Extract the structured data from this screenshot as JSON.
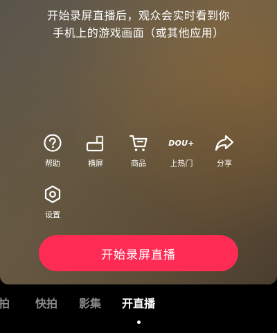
{
  "tip": {
    "line1": "开始录屏直播后，观众会实时看到你",
    "line2": "手机上的游戏画面（或其他应用）"
  },
  "tools": [
    {
      "label": "帮助",
      "icon": "help-icon"
    },
    {
      "label": "横屏",
      "icon": "landscape-icon"
    },
    {
      "label": "商品",
      "icon": "cart-icon"
    },
    {
      "label": "上热门",
      "icon": "dou-plus-icon",
      "icon_text": "DOU+"
    },
    {
      "label": "分享",
      "icon": "share-icon"
    },
    {
      "label": "设置",
      "icon": "settings-icon"
    }
  ],
  "start_button": {
    "label": "开始录屏直播",
    "color": "#fe2c55"
  },
  "modes": [
    {
      "label": "拍",
      "active": false
    },
    {
      "label": "快拍",
      "active": false
    },
    {
      "label": "影集",
      "active": false
    },
    {
      "label": "开直播",
      "active": true
    }
  ]
}
